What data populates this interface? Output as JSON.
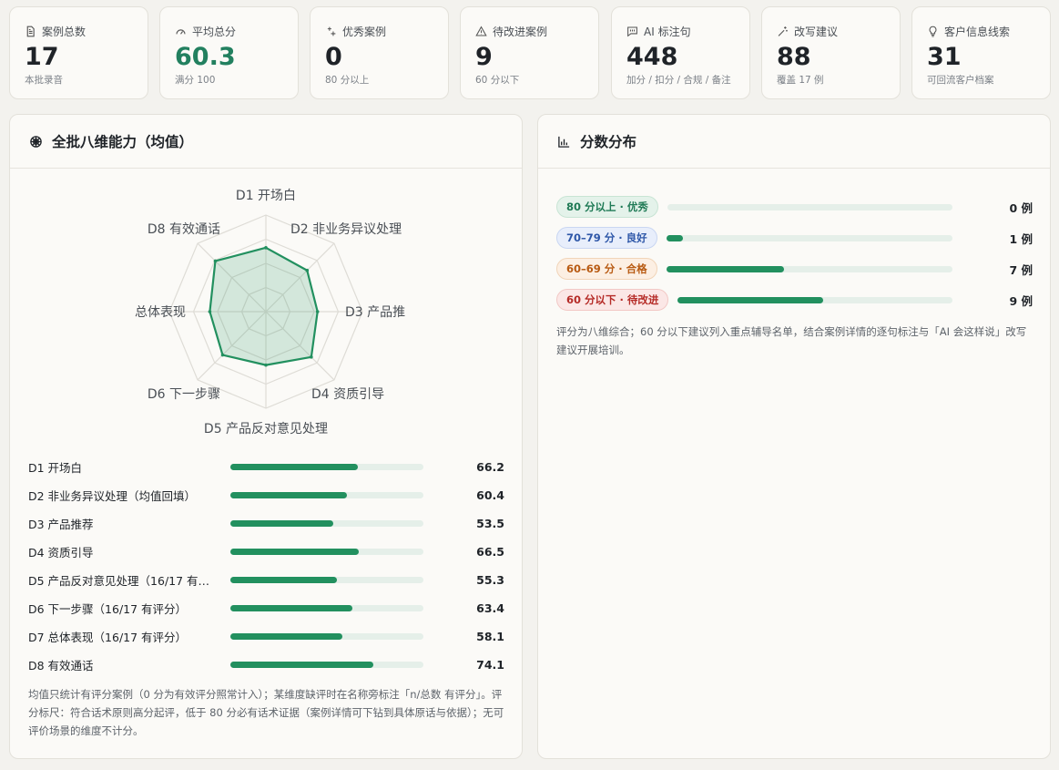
{
  "stats": [
    {
      "icon": "document-icon",
      "label": "案例总数",
      "value": "17",
      "sub": "本批录音",
      "accent": false
    },
    {
      "icon": "gauge-icon",
      "label": "平均总分",
      "value": "60.3",
      "sub": "满分 100",
      "accent": true
    },
    {
      "icon": "sparkle-icon",
      "label": "优秀案例",
      "value": "0",
      "sub": "80 分以上",
      "accent": false
    },
    {
      "icon": "warning-icon",
      "label": "待改进案例",
      "value": "9",
      "sub": "60 分以下",
      "accent": false
    },
    {
      "icon": "message-icon",
      "label": "AI 标注句",
      "value": "448",
      "sub": "加分 / 扣分 / 合规 / 备注",
      "accent": false
    },
    {
      "icon": "wand-icon",
      "label": "改写建议",
      "value": "88",
      "sub": "覆盖 17 例",
      "accent": false
    },
    {
      "icon": "lightbulb-icon",
      "label": "客户信息线索",
      "value": "31",
      "sub": "可回流客户档案",
      "accent": false
    }
  ],
  "radar_panel": {
    "title": "全批八维能力（均值）",
    "icon": "radar-icon",
    "axis_labels": [
      "D1 开场白",
      "D2 非业务异议处理",
      "D3 产品推",
      "D4 资质引导",
      "D5 产品反对意见处理",
      "D6 下一步骤",
      "总体表现",
      "D8 有效通话"
    ],
    "values": [
      66.2,
      60.4,
      53.5,
      66.5,
      55.3,
      63.4,
      58.1,
      74.1
    ],
    "max": 100
  },
  "dimensions": [
    {
      "name": "D1 开场白",
      "score": "66.2",
      "value": 66.2
    },
    {
      "name": "D2 非业务异议处理（均值回填）",
      "score": "60.4",
      "value": 60.4
    },
    {
      "name": "D3 产品推荐",
      "score": "53.5",
      "value": 53.5
    },
    {
      "name": "D4 资质引导",
      "score": "66.5",
      "value": 66.5
    },
    {
      "name": "D5 产品反对意见处理（16/17 有…",
      "score": "55.3",
      "value": 55.3
    },
    {
      "name": "D6 下一步骤（16/17 有评分）",
      "score": "63.4",
      "value": 63.4
    },
    {
      "name": "D7 总体表现（16/17 有评分）",
      "score": "58.1",
      "value": 58.1
    },
    {
      "name": "D8 有效通话",
      "score": "74.1",
      "value": 74.1
    }
  ],
  "radar_footnote": "均值只统计有评分案例（0 分为有效评分照常计入）；某维度缺评时在名称旁标注「n/总数 有评分」。评分标尺：符合话术原则高分起评，低于 80 分必有话术证据（案例详情可下钻到具体原话与依据）；无可评价场景的维度不计分。",
  "dist_panel": {
    "title": "分数分布",
    "icon": "bar-chart-icon",
    "rows": [
      {
        "label": "80 分以上 · 优秀",
        "count": "0 例",
        "cases": 0,
        "style": "b-green"
      },
      {
        "label": "70–79 分 · 良好",
        "count": "1 例",
        "cases": 1,
        "style": "b-blue"
      },
      {
        "label": "60–69 分 · 合格",
        "count": "7 例",
        "cases": 7,
        "style": "b-orange"
      },
      {
        "label": "60 分以下 · 待改进",
        "count": "9 例",
        "cases": 9,
        "style": "b-red"
      }
    ],
    "total_cases": 17,
    "note": "评分为八维综合；60 分以下建议列入重点辅导名单，结合案例详情的逐句标注与「AI 会这样说」改写建议开展培训。"
  },
  "colors": {
    "accent": "#22905f",
    "accent_text": "#22805f",
    "track": "#e5efe9"
  }
}
